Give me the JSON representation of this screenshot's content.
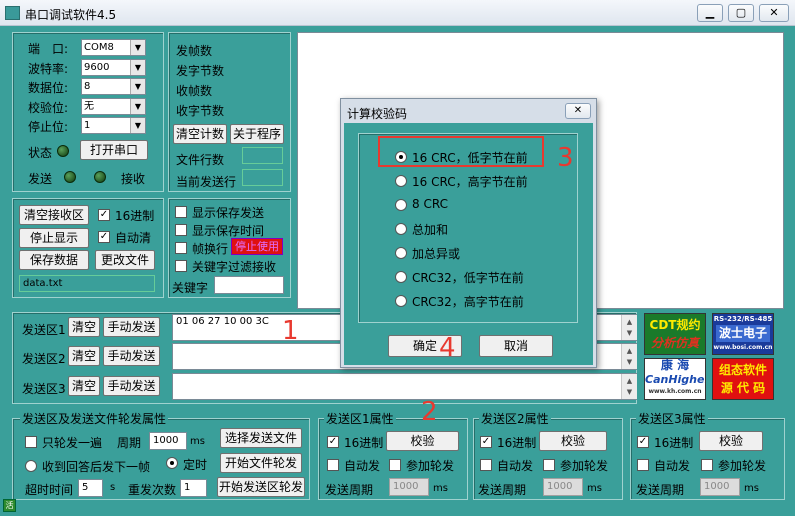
{
  "window": {
    "title": "串口调试软件4.5",
    "min": "▁",
    "max": "▢",
    "close": "✕"
  },
  "serial": {
    "port_label": "端　口:",
    "port_value": "COM8",
    "baud_label": "波特率:",
    "baud_value": "9600",
    "databits_label": "数据位:",
    "databits_value": "8",
    "parity_label": "校验位:",
    "parity_value": "无",
    "stopbits_label": "停止位:",
    "stopbits_value": "1",
    "status_label": "状态",
    "open_button": "打开串口",
    "send_label": "发送",
    "recv_label": "接收"
  },
  "stats": {
    "sent_frames": "发帧数",
    "sent_bytes": "发字节数",
    "recv_frames": "收帧数",
    "recv_bytes": "收字节数",
    "clear_counter": "清空计数",
    "about": "关于程序",
    "file_lines": "文件行数",
    "current_line": "当前发送行"
  },
  "recv": {
    "clear_recv": "清空接收区",
    "hex_label": "16进制",
    "stop_display": "停止显示",
    "auto_clear": "自动清",
    "save_data": "保存数据",
    "change_file": "更改文件",
    "file_name": "data.txt"
  },
  "options": {
    "show_save_send": "显示保存发送",
    "show_save_time": "显示保存时间",
    "frame_wrap": "帧换行",
    "stop_using": "停止使用",
    "keyword_filter": "关键字过滤接收",
    "keyword_label": "关键字"
  },
  "send_areas": [
    {
      "label": "发送区1",
      "clear": "清空",
      "manual": "手动发送",
      "content": "01 06 27 10 00 3C"
    },
    {
      "label": "发送区2",
      "clear": "清空",
      "manual": "手动发送",
      "content": ""
    },
    {
      "label": "发送区3",
      "clear": "清空",
      "manual": "手动发送",
      "content": ""
    }
  ],
  "ads": [
    {
      "line1": "CDT规约",
      "line2": "分析仿真"
    },
    {
      "line1": "RS-232/RS-485",
      "line2": "波士电子",
      "line3": "www.bosi.com.cn"
    },
    {
      "line1": "康 海",
      "line2": "CanHigher",
      "line3": "www.kh.com.cn"
    },
    {
      "line1": "组态软件",
      "line2": "源 代 码"
    }
  ],
  "rotate": {
    "title": "发送区及发送文件轮发属性",
    "only_once": "只轮发一遍",
    "period_label": "周期",
    "period_value": "1000",
    "ms": "ms",
    "select_file": "选择发送文件",
    "after_reply": "收到回答后发下一帧",
    "timed": "定时",
    "start_file_rotate": "开始文件轮发",
    "timeout_label": "超时时间",
    "timeout_value": "5",
    "s": "s",
    "resend_label": "重发次数",
    "resend_value": "1",
    "start_area_rotate": "开始发送区轮发"
  },
  "area_props": [
    {
      "title": "发送区1属性",
      "hex": "16进制",
      "checksum": "校验",
      "auto_send": "自动发",
      "join_rotate": "参加轮发",
      "period_label": "发送周期",
      "period_value": "1000",
      "ms": "ms"
    },
    {
      "title": "发送区2属性",
      "hex": "16进制",
      "checksum": "校验",
      "auto_send": "自动发",
      "join_rotate": "参加轮发",
      "period_label": "发送周期",
      "period_value": "1000",
      "ms": "ms"
    },
    {
      "title": "发送区3属性",
      "hex": "16进制",
      "checksum": "校验",
      "auto_send": "自动发",
      "join_rotate": "参加轮发",
      "period_label": "发送周期",
      "period_value": "1000",
      "ms": "ms"
    }
  ],
  "dialog": {
    "title": "计算校验码",
    "close": "✕",
    "options": [
      "16 CRC，低字节在前",
      "16 CRC，高字节在前",
      "8 CRC",
      "总加和",
      "加总异或",
      "CRC32，低字节在前",
      "CRC32，高字节在前"
    ],
    "selected_index": 0,
    "ok": "确定",
    "cancel": "取消"
  },
  "annotations": {
    "n1": "1",
    "n2": "2",
    "n3": "3",
    "n4": "4"
  },
  "statusbar": {
    "icon_text": "活"
  },
  "colors": {
    "bg": "#3a9f9a",
    "annotation": "#e8392f"
  }
}
